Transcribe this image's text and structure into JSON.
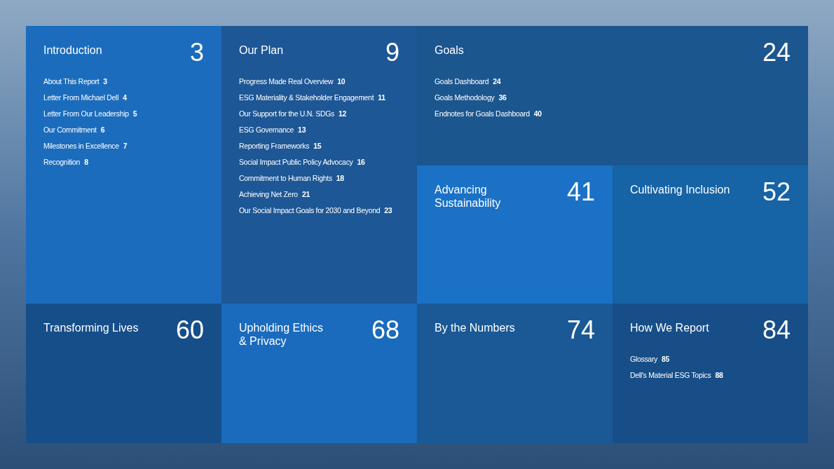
{
  "sections": [
    {
      "kind": "tall",
      "title": "Introduction",
      "page": "3",
      "color": "#1b6cbd",
      "items": [
        {
          "label": "About This Report",
          "page": "3"
        },
        {
          "label": "Letter From Michael Dell",
          "page": "4"
        },
        {
          "label": "Letter From Our Leadership",
          "page": "5"
        },
        {
          "label": "Our Commitment",
          "page": "6"
        },
        {
          "label": "Milestones in Excellence",
          "page": "7"
        },
        {
          "label": "Recognition",
          "page": "8"
        }
      ]
    },
    {
      "kind": "tall",
      "title": "Our Plan",
      "page": "9",
      "color": "#1d5795",
      "items": [
        {
          "label": "Progress Made Real Overview",
          "page": "10"
        },
        {
          "label": "ESG Materiality & Stakeholder Engagement",
          "page": "11"
        },
        {
          "label": "Our Support for the U.N. SDGs",
          "page": "12"
        },
        {
          "label": "ESG Governance",
          "page": "13"
        },
        {
          "label": "Reporting Frameworks",
          "page": "15"
        },
        {
          "label": "Social Impact Public Policy Advocacy",
          "page": "16"
        },
        {
          "label": "Commitment to Human Rights",
          "page": "18"
        },
        {
          "label": "Achieving Net Zero",
          "page": "21"
        },
        {
          "label": "Our Social Impact Goals for 2030 and Beyond",
          "page": "23"
        }
      ]
    },
    {
      "kind": "wide",
      "title": "Goals",
      "page": "24",
      "color": "#1c568f",
      "items": [
        {
          "label": "Goals Dashboard",
          "page": "24"
        },
        {
          "label": "Goals Methodology",
          "page": "36"
        },
        {
          "label": "Endnotes for Goals Dashboard",
          "page": "40"
        }
      ]
    },
    {
      "kind": "normal",
      "title": "Advancing\nSustainability",
      "page": "41",
      "color": "#1a71c6"
    },
    {
      "kind": "normal",
      "title": "Cultivating Inclusion",
      "page": "52",
      "color": "#1663a6"
    },
    {
      "kind": "normal",
      "title": "Transforming Lives",
      "page": "60",
      "color": "#164e8a"
    },
    {
      "kind": "normal",
      "title": "Upholding Ethics\n& Privacy",
      "page": "68",
      "color": "#1a6bbd"
    },
    {
      "kind": "normal",
      "title": "By the Numbers",
      "page": "74",
      "color": "#1a5996"
    },
    {
      "kind": "normal",
      "title": "How We Report",
      "page": "84",
      "color": "#174e88",
      "items": [
        {
          "label": "Glossary",
          "page": "85"
        },
        {
          "label": "Dell's Material ESG Topics",
          "page": "88"
        }
      ]
    }
  ]
}
